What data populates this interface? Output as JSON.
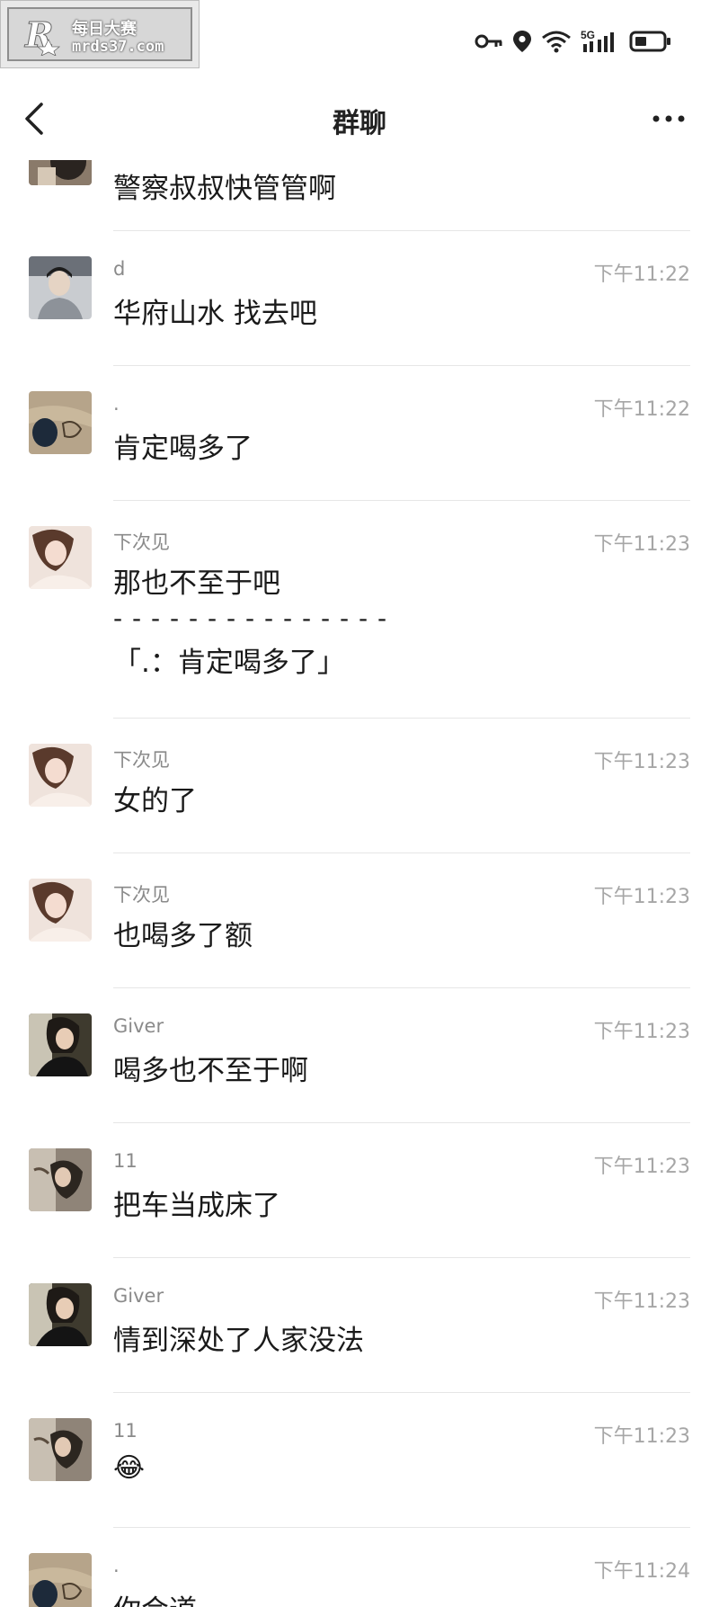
{
  "watermark": {
    "name": "每日大赛",
    "site": "mrds37.com"
  },
  "status_bar": {
    "icons": [
      "key-icon",
      "location-icon",
      "wifi-icon",
      "signal-5g-icon",
      "battery-icon"
    ],
    "network": "5G"
  },
  "header": {
    "title": "群聊",
    "back_icon": "chevron-left-icon",
    "more_icon": "more-icon"
  },
  "messages": [
    {
      "sender": "",
      "time": "",
      "text": "警察叔叔快管管啊",
      "avatar": "photo-dark"
    },
    {
      "sender": "d",
      "time": "下午11:22",
      "text": "华府山水 找去吧",
      "avatar": "photo-boy"
    },
    {
      "sender": ".",
      "time": "下午11:22",
      "text": "肯定喝多了",
      "avatar": "photo-sand"
    },
    {
      "sender": "下次见",
      "time": "下午11:23",
      "text": "那也不至于吧",
      "quote_sep": "- - - - - - - - - - - - - - -",
      "quote": "「.：肯定喝多了」",
      "avatar": "photo-girl"
    },
    {
      "sender": "下次见",
      "time": "下午11:23",
      "text": "女的了",
      "avatar": "photo-girl"
    },
    {
      "sender": "下次见",
      "time": "下午11:23",
      "text": "也喝多了额",
      "avatar": "photo-girl"
    },
    {
      "sender": "Giver",
      "time": "下午11:23",
      "text": "喝多也不至于啊",
      "avatar": "photo-giver"
    },
    {
      "sender": "11",
      "time": "下午11:23",
      "text": "把车当成床了",
      "avatar": "photo-eleven"
    },
    {
      "sender": "Giver",
      "time": "下午11:23",
      "text": "情到深处了人家没法",
      "avatar": "photo-giver"
    },
    {
      "sender": "11",
      "time": "下午11:23",
      "text": "😂",
      "avatar": "photo-eleven"
    },
    {
      "sender": ".",
      "time": "下午11:24",
      "text": "你会道",
      "avatar": "photo-sand"
    }
  ],
  "colors": {
    "sender": "#8a8a8a",
    "time": "#a6a6a6",
    "divider": "#e6e6e6"
  }
}
